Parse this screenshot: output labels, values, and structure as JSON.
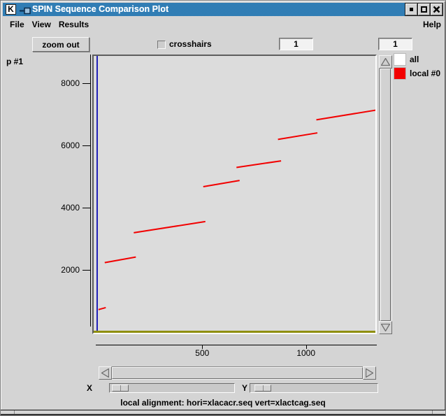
{
  "window": {
    "title": "SPIN Sequence Comparison Plot",
    "app_icon_letter": "K"
  },
  "menubar": {
    "items": [
      "File",
      "View",
      "Results"
    ],
    "help": "Help"
  },
  "toolbar": {
    "zoom_out_label": "zoom out",
    "crosshairs_label": "crosshairs",
    "field1_value": "1",
    "field2_value": "1"
  },
  "plot_label": "p #1",
  "legend": {
    "items": [
      {
        "label": "all",
        "color": "#ffffff"
      },
      {
        "label": "local #0",
        "color": "#f20000"
      }
    ]
  },
  "chart_data": {
    "type": "line",
    "title": "",
    "xlabel": "",
    "ylabel": "p #1",
    "xlim": [
      0,
      1360
    ],
    "ylim": [
      0,
      8900
    ],
    "x_ticks": [
      500,
      1000
    ],
    "y_ticks": [
      2000,
      4000,
      6000,
      8000
    ],
    "grid": false,
    "legend_position": "top-right",
    "origin_line_color": "#2323b8",
    "baseline_color": "#8f8f0f",
    "series": [
      {
        "name": "local #0",
        "color": "#f20000",
        "segments": [
          [
            [
              0,
              730
            ],
            [
              35,
              795
            ]
          ],
          [
            [
              30,
              2240
            ],
            [
              180,
              2420
            ]
          ],
          [
            [
              170,
              3200
            ],
            [
              515,
              3560
            ]
          ],
          [
            [
              505,
              4680
            ],
            [
              680,
              4880
            ]
          ],
          [
            [
              665,
              5300
            ],
            [
              880,
              5510
            ]
          ],
          [
            [
              865,
              6200
            ],
            [
              1055,
              6410
            ]
          ],
          [
            [
              1050,
              6830
            ],
            [
              1345,
              7150
            ]
          ]
        ]
      }
    ]
  },
  "sliders": {
    "x_label": "X",
    "y_label": "Y"
  },
  "statusbar": {
    "text": "local alignment: hori=xlacacr.seq vert=xlactcag.seq"
  }
}
